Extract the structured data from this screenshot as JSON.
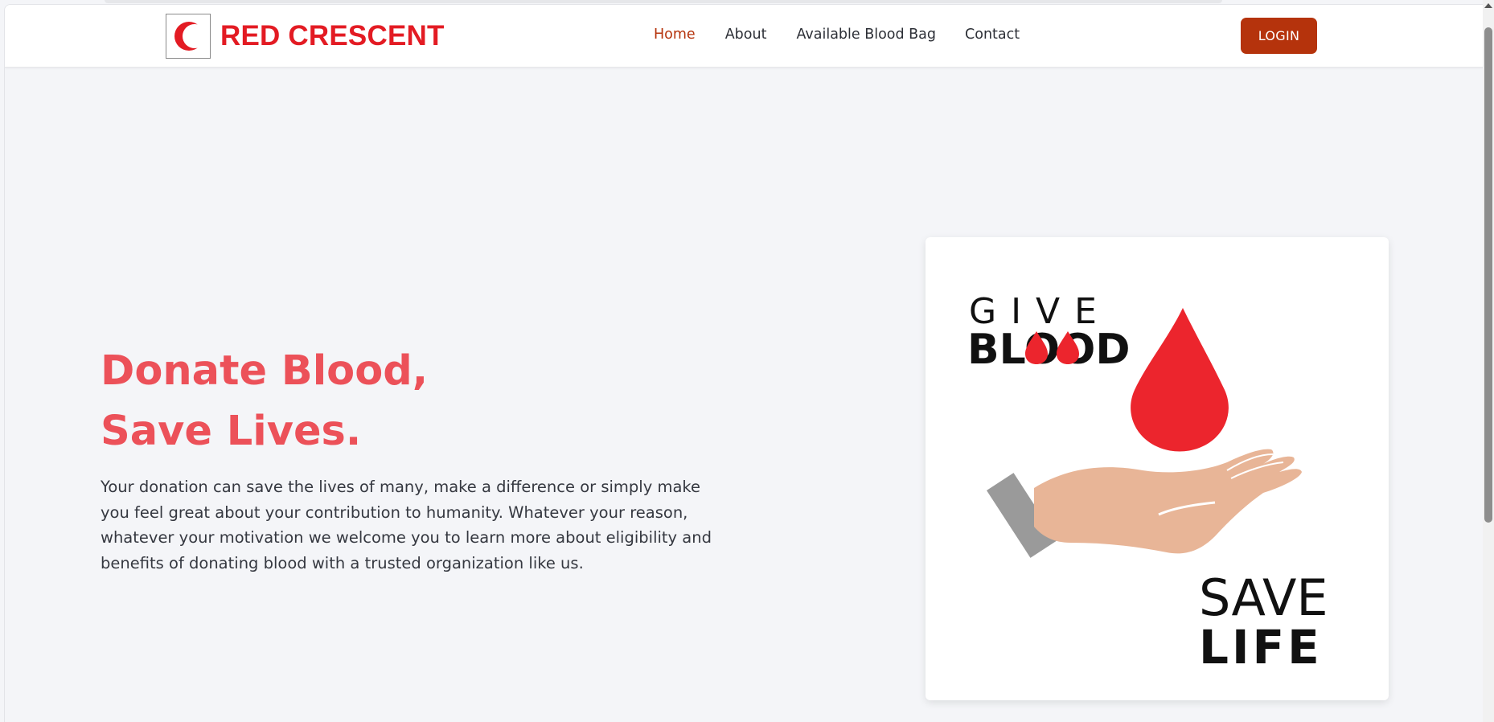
{
  "brand": {
    "name": "RED CRESCENT",
    "logo_icon": "crescent-icon",
    "accent_color": "#e31b23"
  },
  "nav": {
    "items": [
      {
        "label": "Home",
        "active": true,
        "color": "#b5330c"
      },
      {
        "label": "About",
        "active": false
      },
      {
        "label": "Available Blood Bag",
        "active": false
      },
      {
        "label": "Contact",
        "active": false
      }
    ],
    "login_label": "LOGIN",
    "login_color": "#b5330c"
  },
  "hero": {
    "title": "Donate Blood, Save Lives.",
    "description": "Your donation can save the lives of many, make a difference or simply make you feel great about your contribution to humanity. Whatever your reason, whatever your motivation we welcome you to learn more about eligibility and benefits of donating blood with a trusted organization like us.",
    "title_color": "#ec5159"
  },
  "illustration": {
    "line1": "G I V E",
    "line2": "BLOOD",
    "line3": "SAVE",
    "line4": "LIFE",
    "drop_color": "#ec252d",
    "hand_color": "#e8b597",
    "cuff_color": "#9a9a9a"
  }
}
